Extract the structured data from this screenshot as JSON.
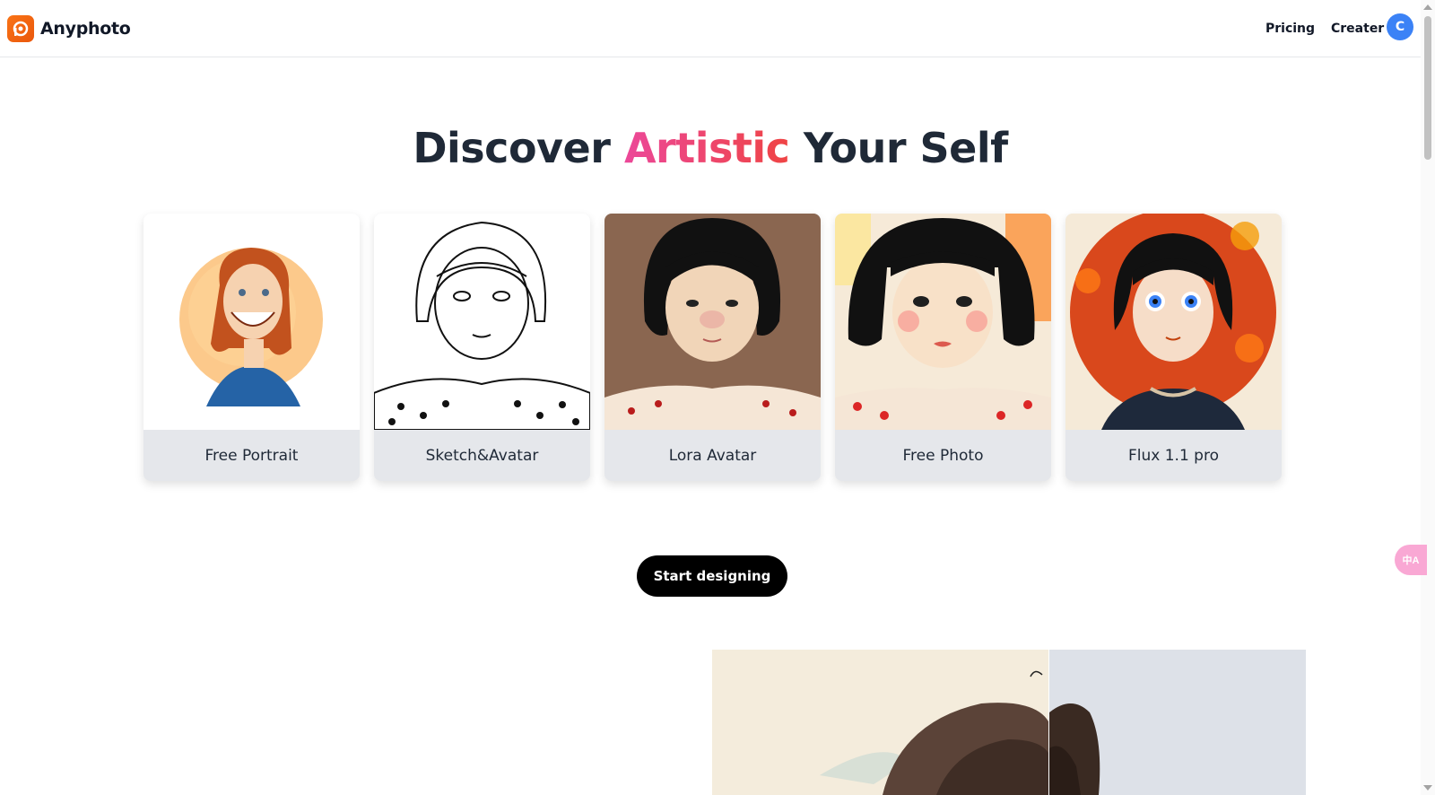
{
  "brand": {
    "name": "Anyphoto",
    "logo_icon": "camera-aperture-icon",
    "accent": "#f97316"
  },
  "nav": {
    "pricing": "Pricing",
    "creater": "Creater"
  },
  "user": {
    "initial": "C",
    "color": "#3b82f6"
  },
  "hero": {
    "prefix": "Discover ",
    "accent": "Artistic",
    "suffix": " Your Self"
  },
  "cards": [
    {
      "label": "Free Portrait"
    },
    {
      "label": "Sketch&Avatar"
    },
    {
      "label": "Lora Avatar"
    },
    {
      "label": "Free Photo"
    },
    {
      "label": "Flux 1.1 pro"
    }
  ],
  "cta": {
    "label": "Start designing"
  },
  "translate": {
    "icon": "translate-icon",
    "text": "中A"
  }
}
